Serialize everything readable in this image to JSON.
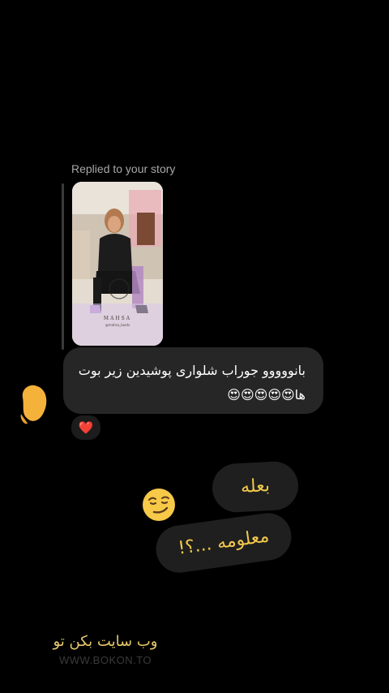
{
  "reply": {
    "label": "Replied to your story",
    "story_caption": "MAHSA",
    "story_handle": "@mahsa_boots"
  },
  "incoming_message": {
    "line1": "بانووووو جوراب شلواری پوشیدین زیر بوت",
    "line2": "ها😍😍😍😍😍"
  },
  "reaction": {
    "emoji": "❤️"
  },
  "stickers": {
    "baleh": "بعله",
    "maloome": "معلومه ...؟!",
    "smirk_icon": "smirk-face-icon"
  },
  "watermark": {
    "fa": "وب سایت بکن تو",
    "en": "WWW.BOKON.TO"
  },
  "colors": {
    "background": "#000000",
    "bubble": "#262626",
    "sticker_text": "#f2c94c",
    "reaction_heart": "#e8263c",
    "emoji_yellow": "#f7c948"
  }
}
